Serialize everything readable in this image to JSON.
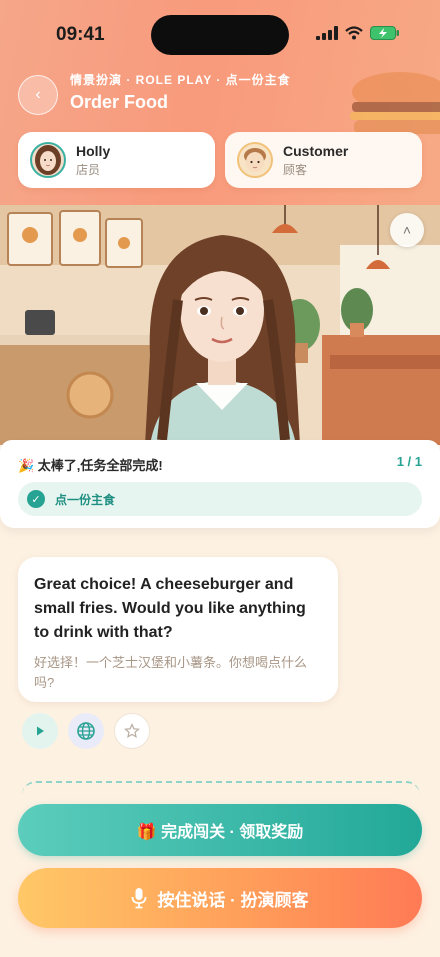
{
  "status_bar": {
    "time": "09:41"
  },
  "header": {
    "subtitle": "情景扮演 · ROLE PLAY · 点一份主食",
    "title": "Order Food",
    "back_icon": "chevron-left-icon"
  },
  "roles": [
    {
      "name": "Holly",
      "role": "店员",
      "avatar": "girl-avatar"
    },
    {
      "name": "Customer",
      "role": "顾客",
      "avatar": "boy-avatar"
    }
  ],
  "scene": {
    "collapse_icon": "chevron-up-icon"
  },
  "task_panel": {
    "message": "🎉 太棒了,任务全部完成!",
    "count": "1 / 1",
    "items": [
      {
        "label": "点一份主食",
        "done": true
      }
    ]
  },
  "chat": {
    "english": "Great choice! A cheeseburger and small fries. Would you like anything to drink with that?",
    "chinese": "好选择！一个芝士汉堡和小薯条。你想喝点什么吗?",
    "actions": [
      "play-icon",
      "globe-icon",
      "star-icon"
    ]
  },
  "buttons": {
    "reward": "🎁 完成闯关 · 领取奖励",
    "speak": "按住说话 · 扮演顾客"
  },
  "colors": {
    "header_start": "#f6a689",
    "accent_teal": "#27a394",
    "speak_orange": "#ff7a55",
    "background": "#fdf1e2"
  }
}
